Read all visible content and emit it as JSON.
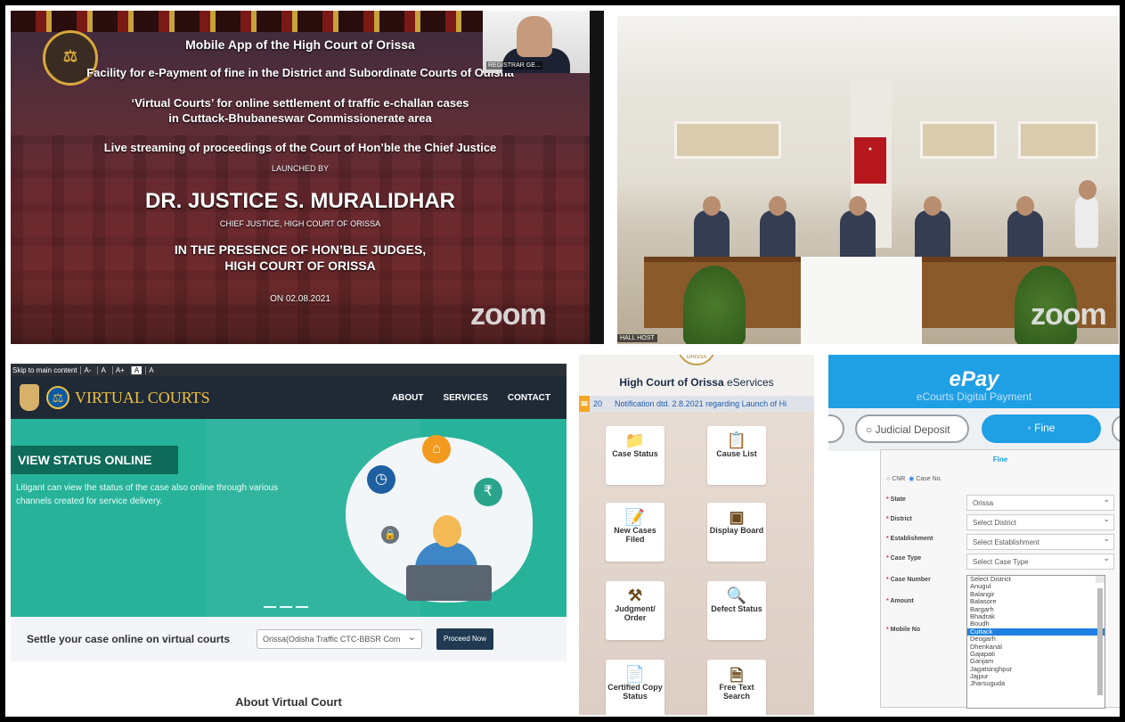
{
  "slide": {
    "line1": "Mobile App of the High Court of Orissa",
    "line2": "Facility for e-Payment of fine in the District and Subordinate Courts of Odisha",
    "line3": "‘Virtual Courts’ for online settlement of traffic e-challan cases",
    "line4": "in Cuttack-Bhubaneswar Commissionerate area",
    "line5": "Live streaming of proceedings of the Court of Hon’ble the Chief Justice",
    "launched_by": "LAUNCHED BY",
    "name": "DR. JUSTICE S. MURALIDHAR",
    "designation": "CHIEF JUSTICE, HIGH COURT OF ORISSA",
    "presence1": "IN THE PRESENCE OF HON’BLE JUDGES,",
    "presence2": "HIGH COURT OF ORISSA",
    "date": "ON 02.08.2021",
    "seal_text": "HIGH COURT ORISSA",
    "camera_label": "REGISTRAR GE...",
    "zoom": "zoom"
  },
  "hall": {
    "host_label": "HALL HOST",
    "zoom": "zoom"
  },
  "virtual_courts": {
    "skip_link": "Skip to main content",
    "font_sizes": [
      "A-",
      "A",
      "A+",
      "A",
      "A"
    ],
    "brand": "VIRTUAL COURTS",
    "menu": [
      "ABOUT",
      "SERVICES",
      "CONTACT"
    ],
    "hero_title": "VIEW STATUS ONLINE",
    "hero_desc": "Litigant can view the status of the case also online through various channels created for service delivery.",
    "settle_label": "Settle your case online on virtual courts",
    "court_select": "Orissa(Odisha Traffic CTC-BBSR Com",
    "proceed_button": "Proceed Now",
    "about_heading": "About Virtual Court"
  },
  "eservices": {
    "title_bold": "High Court of Orissa",
    "title_rest": " eServices",
    "ticker_count": "20",
    "ticker_text": "Notification dtd. 2.8.2021 regarding Launch of Hi",
    "cards": [
      {
        "label": "Case Status",
        "icon": "case-status-icon"
      },
      {
        "label": "Cause List",
        "icon": "cause-list-icon"
      },
      {
        "label": "New Cases Filed",
        "icon": "new-cases-icon"
      },
      {
        "label": "Display Board",
        "icon": "display-board-icon"
      },
      {
        "label": "Judgment/ Order",
        "icon": "gavel-icon"
      },
      {
        "label": "Defect Status",
        "icon": "defect-search-icon"
      },
      {
        "label": "Certified Copy Status",
        "icon": "certified-copy-icon"
      },
      {
        "label": "Free Text Search",
        "icon": "text-search-icon"
      }
    ],
    "seal_text": "ORISSA"
  },
  "epay": {
    "title": "ePay",
    "subtitle": "eCourts Digital Payment",
    "tab_judicial": "Judicial Deposit",
    "tab_fine": "Fine",
    "form_title": "Fine",
    "radio_cnr": "CNR",
    "radio_case": "Case No.",
    "labels": {
      "state": "State",
      "district": "District",
      "establishment": "Establishment",
      "case_type": "Case Type",
      "case_number": "Case Number",
      "amount": "Amount",
      "mobile": "Mobile No"
    },
    "values": {
      "state": "Orissa",
      "district": "Select District",
      "establishment": "Select Establishment",
      "case_type": "Select Case Type"
    },
    "districts": [
      "Select District",
      "Anugul",
      "Balangir",
      "Balasore",
      "Bargarh",
      "Bhadrak",
      "Boudh",
      "Cuttack",
      "Deogarh",
      "Dhenkanal",
      "Gajapati",
      "Ganjam",
      "Jagatsinghpur",
      "Jajpur",
      "Jharsuguda"
    ],
    "selected_district": "Cuttack",
    "accent": "#1f9fe4"
  }
}
